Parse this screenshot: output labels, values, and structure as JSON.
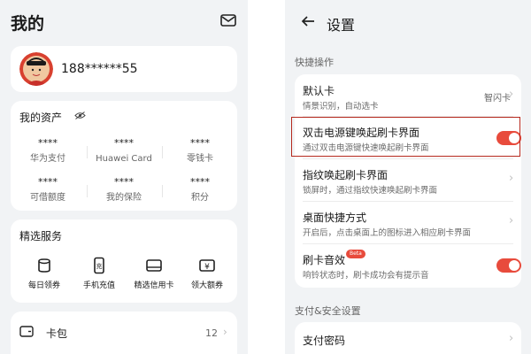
{
  "left": {
    "title": "我的",
    "phone": "188******55",
    "assets": {
      "title": "我的资产",
      "items": [
        {
          "value": "****",
          "label": "华为支付"
        },
        {
          "value": "****",
          "label": "Huawei Card"
        },
        {
          "value": "****",
          "label": "零钱卡"
        },
        {
          "value": "****",
          "label": "可借额度"
        },
        {
          "value": "****",
          "label": "我的保险"
        },
        {
          "value": "****",
          "label": "积分"
        }
      ]
    },
    "services": {
      "title": "精选服务",
      "items": [
        {
          "label": "每日领券",
          "icon": "coupon-icon"
        },
        {
          "label": "手机充值",
          "icon": "phone-recharge-icon"
        },
        {
          "label": "精选信用卡",
          "icon": "credit-card-icon"
        },
        {
          "label": "领大额券",
          "icon": "yen-coupon-icon"
        }
      ]
    },
    "wallet": {
      "label": "卡包",
      "count": "12"
    }
  },
  "right": {
    "title": "设置",
    "section1": "快捷操作",
    "rows": [
      {
        "title": "默认卡",
        "subtitle": "情景识别，自动选卡",
        "value": "智闪卡",
        "control": "chevron"
      },
      {
        "title": "双击电源键唤起刷卡界面",
        "subtitle": "通过双击电源键快速唤起刷卡界面",
        "control": "toggle",
        "on": true
      },
      {
        "title": "指纹唤起刷卡界面",
        "subtitle": "锁屏时，通过指纹快速唤起刷卡界面",
        "control": "chevron"
      },
      {
        "title": "桌面快捷方式",
        "subtitle": "开启后，点击桌面上的图标进入相应刷卡界面",
        "control": "chevron"
      },
      {
        "title": "刷卡音效",
        "subtitle": "响铃状态时，刷卡成功会有提示音",
        "badge": "Beta",
        "control": "toggle",
        "on": true
      }
    ],
    "section2": "支付&安全设置",
    "pay_row": {
      "title": "支付密码"
    }
  },
  "colors": {
    "accent": "#e84b3c",
    "highlight_border": "#b5281d",
    "background": "#f1f3f5"
  }
}
